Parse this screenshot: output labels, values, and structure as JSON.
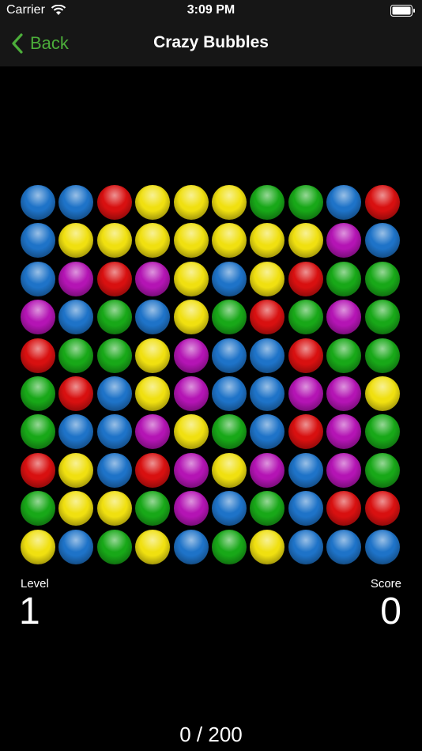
{
  "status_bar": {
    "carrier": "Carrier",
    "time": "3:09 PM",
    "wifi_icon": "wifi-icon",
    "battery_icon": "battery-icon"
  },
  "nav": {
    "back_label": "Back",
    "title": "Crazy Bubbles",
    "accent_color": "#4cae3a"
  },
  "colors": {
    "B": "#1e73c8",
    "R": "#d81010",
    "Y": "#f0e010",
    "G": "#18a818",
    "P": "#b414b4"
  },
  "board": {
    "rows": [
      [
        "B",
        "B",
        "R",
        "Y",
        "Y",
        "Y",
        "G",
        "G",
        "B",
        "R"
      ],
      [
        "B",
        "Y",
        "Y",
        "Y",
        "Y",
        "Y",
        "Y",
        "Y",
        "P",
        "B"
      ],
      [
        "B",
        "P",
        "R",
        "P",
        "Y",
        "B",
        "Y",
        "R",
        "G",
        "G"
      ],
      [
        "P",
        "B",
        "G",
        "B",
        "Y",
        "G",
        "R",
        "G",
        "P",
        "G"
      ],
      [
        "R",
        "G",
        "G",
        "Y",
        "P",
        "B",
        "B",
        "R",
        "G",
        "G"
      ],
      [
        "G",
        "R",
        "B",
        "Y",
        "P",
        "B",
        "B",
        "P",
        "P",
        "Y"
      ],
      [
        "G",
        "B",
        "B",
        "P",
        "Y",
        "G",
        "B",
        "R",
        "P",
        "G"
      ],
      [
        "R",
        "Y",
        "B",
        "R",
        "P",
        "Y",
        "P",
        "B",
        "P",
        "G"
      ],
      [
        "G",
        "Y",
        "Y",
        "G",
        "P",
        "B",
        "G",
        "B",
        "R",
        "R"
      ],
      [
        "Y",
        "B",
        "G",
        "Y",
        "B",
        "G",
        "Y",
        "B",
        "B",
        "B"
      ]
    ]
  },
  "stats": {
    "level_label": "Level",
    "level_value": "1",
    "score_label": "Score",
    "score_value": "0"
  },
  "progress": {
    "text": "0 / 200"
  }
}
